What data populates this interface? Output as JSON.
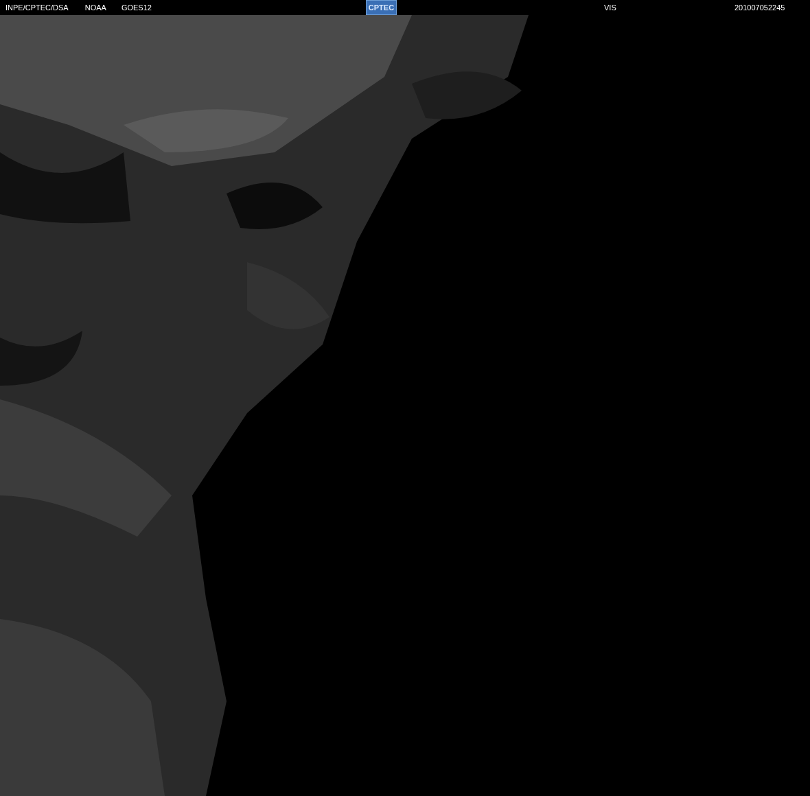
{
  "header": {
    "sources": [
      "INPE/CPTEC/DSA",
      "NOAA",
      "GOES12"
    ],
    "logo": "CPTEC",
    "channel": "VIS",
    "timestamp": "201007052245"
  }
}
